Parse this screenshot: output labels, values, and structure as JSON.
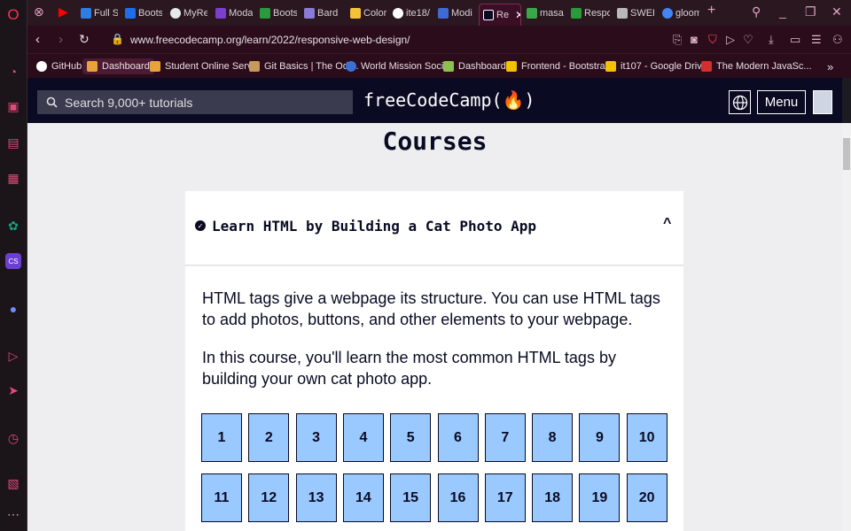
{
  "browser": {
    "tabs": [
      {
        "label": "Full St",
        "favicon_color": "#2f7de1"
      },
      {
        "label": "Boots",
        "favicon_color": "#1d6ee8"
      },
      {
        "label": "MyRe",
        "favicon_color": "#e8e8e8"
      },
      {
        "label": "Moda",
        "favicon_color": "#7a3fd1"
      },
      {
        "label": "Boots",
        "favicon_color": "#2b9a3c"
      },
      {
        "label": "Bard",
        "favicon_color": "#8a7bd6"
      },
      {
        "label": "Color",
        "favicon_color": "#f3c13a"
      },
      {
        "label": "ite18/",
        "favicon_color": "#ffffff"
      },
      {
        "label": "Modi",
        "favicon_color": "#3f6ad1"
      },
      {
        "label": "Re",
        "favicon_color": "#ffffff"
      },
      {
        "label": "masa",
        "favicon_color": "#3ca64a"
      },
      {
        "label": "Respo",
        "favicon_color": "#2b9a3c"
      },
      {
        "label": "SWER",
        "favicon_color": "#b8b8b8"
      },
      {
        "label": "gloom",
        "favicon_color": "#4285f4"
      }
    ],
    "url": "www.freecodecamp.org/learn/2022/responsive-web-design/",
    "bookmarks": [
      {
        "label": "GitHub",
        "favicon_color": "#ffffff"
      },
      {
        "label": "Dashboard",
        "favicon_color": "#e8a33a"
      },
      {
        "label": "Student Online Serv...",
        "favicon_color": "#e8a33a"
      },
      {
        "label": "Git Basics | The Odi...",
        "favicon_color": "#c79a5a"
      },
      {
        "label": "World Mission Soci...",
        "favicon_color": "#3a6fd6"
      },
      {
        "label": "Dashboard",
        "favicon_color": "#8bc34a"
      },
      {
        "label": "Frontend - Bootstra...",
        "favicon_color": "#f2c200"
      },
      {
        "label": "it107 - Google Drive",
        "favicon_color": "#f2c200"
      },
      {
        "label": "The Modern JavaSc...",
        "favicon_color": "#d32f2f"
      }
    ],
    "bookmarks_overflow": "»"
  },
  "fcc": {
    "search_placeholder": "Search 9,000+ tutorials",
    "logo": "freeCodeCamp(🔥)",
    "menu_label": "Menu"
  },
  "page": {
    "heading": "Courses",
    "course": {
      "title": "Learn HTML by Building a Cat Photo App",
      "paragraph_1": "HTML tags give a webpage its structure. You can use HTML tags to add photos, buttons, and other elements to your webpage.",
      "paragraph_2": "In this course, you'll learn the most common HTML tags by building your own cat photo app.",
      "steps": [
        "1",
        "2",
        "3",
        "4",
        "5",
        "6",
        "7",
        "8",
        "9",
        "10",
        "11",
        "12",
        "13",
        "14",
        "15",
        "16",
        "17",
        "18",
        "19",
        "20"
      ]
    }
  },
  "colors": {
    "fcc_nav": "#0a0a23",
    "step_fill": "#99c9ff",
    "browser_accent": "#ff2f5a"
  }
}
